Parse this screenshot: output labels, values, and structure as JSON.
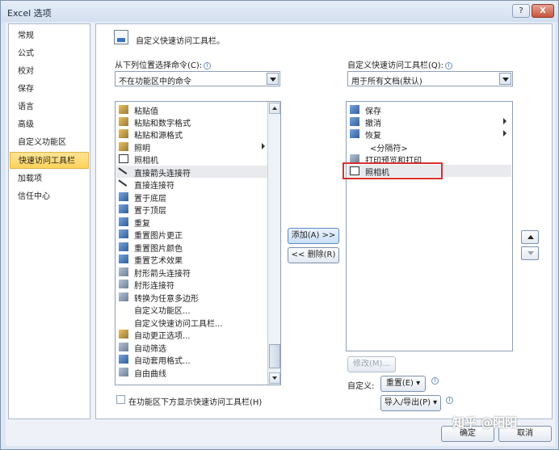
{
  "window": {
    "title": "Excel 选项",
    "help_label": "?",
    "close_label": "X"
  },
  "nav": {
    "items": [
      {
        "label": "常规",
        "active": false
      },
      {
        "label": "公式",
        "active": false
      },
      {
        "label": "校对",
        "active": false
      },
      {
        "label": "保存",
        "active": false
      },
      {
        "label": "语言",
        "active": false
      },
      {
        "label": "高级",
        "active": false
      },
      {
        "label": "自定义功能区",
        "active": false
      },
      {
        "label": "快速访问工具栏",
        "active": true
      },
      {
        "label": "加载项",
        "active": false
      },
      {
        "label": "信任中心",
        "active": false
      }
    ]
  },
  "header": {
    "title": "自定义快速访问工具栏。"
  },
  "left": {
    "label": "从下列位置选择命令(C):",
    "source_value": "不在功能区中的命令",
    "commands": [
      {
        "label": "粘贴值",
        "icon": "paste-icon",
        "submenu": false
      },
      {
        "label": "粘贴和数字格式",
        "icon": "paste-icon",
        "submenu": false
      },
      {
        "label": "粘贴和源格式",
        "icon": "paste-icon",
        "submenu": false
      },
      {
        "label": "照明",
        "icon": "lighting-icon",
        "submenu": true
      },
      {
        "label": "照相机",
        "icon": "camera-icon",
        "submenu": false
      },
      {
        "label": "直接箭头连接符",
        "icon": "arrow-connector-icon",
        "submenu": false,
        "selected": true
      },
      {
        "label": "直接连接符",
        "icon": "line-connector-icon",
        "submenu": false
      },
      {
        "label": "置于底层",
        "icon": "send-back-icon",
        "submenu": false
      },
      {
        "label": "置于顶层",
        "icon": "bring-front-icon",
        "submenu": false
      },
      {
        "label": "重复",
        "icon": "repeat-icon",
        "submenu": false
      },
      {
        "label": "重置图片更正",
        "icon": "picture-icon",
        "submenu": false
      },
      {
        "label": "重置图片颜色",
        "icon": "picture-icon",
        "submenu": false
      },
      {
        "label": "重置艺术效果",
        "icon": "picture-icon",
        "submenu": false
      },
      {
        "label": "肘形箭头连接符",
        "icon": "elbow-connector-icon",
        "submenu": false
      },
      {
        "label": "肘形连接符",
        "icon": "elbow-connector-icon",
        "submenu": false
      },
      {
        "label": "转换为任意多边形",
        "icon": "freeform-icon",
        "submenu": false
      },
      {
        "label": "自定义功能区...",
        "icon": "",
        "submenu": false
      },
      {
        "label": "自定义快速访问工具栏...",
        "icon": "",
        "submenu": false
      },
      {
        "label": "自动更正选项...",
        "icon": "autocorrect-icon",
        "submenu": false
      },
      {
        "label": "自动筛选",
        "icon": "filter-icon",
        "submenu": false
      },
      {
        "label": "自动套用格式...",
        "icon": "autoformat-icon",
        "submenu": false
      },
      {
        "label": "自由曲线",
        "icon": "curve-icon",
        "submenu": false
      }
    ],
    "show_below_label": "在功能区下方显示快速访问工具栏(H)"
  },
  "middle": {
    "add_label": "添加(A) >>",
    "remove_label": "<< 删除(R)"
  },
  "right": {
    "label": "自定义快速访问工具栏(Q):",
    "target_value": "用于所有文档(默认)",
    "items": [
      {
        "label": "保存",
        "icon": "save-icon",
        "submenu": false
      },
      {
        "label": "撤消",
        "icon": "undo-icon",
        "submenu": true
      },
      {
        "label": "恢复",
        "icon": "redo-icon",
        "submenu": true
      },
      {
        "label": "<分隔符>",
        "icon": "",
        "submenu": false
      },
      {
        "label": "打印预览和打印",
        "icon": "print-preview-icon",
        "submenu": false
      },
      {
        "label": "照相机",
        "icon": "camera-icon",
        "submenu": false,
        "selected": true
      }
    ],
    "modify_label": "修改(M)...",
    "customize_label": "自定义:",
    "reset_label": "重置(E) ▾",
    "import_export_label": "导入/导出(P) ▾"
  },
  "footer": {
    "ok_label": "确定",
    "cancel_label": "取消"
  },
  "watermark": "知乎 @阳阳"
}
